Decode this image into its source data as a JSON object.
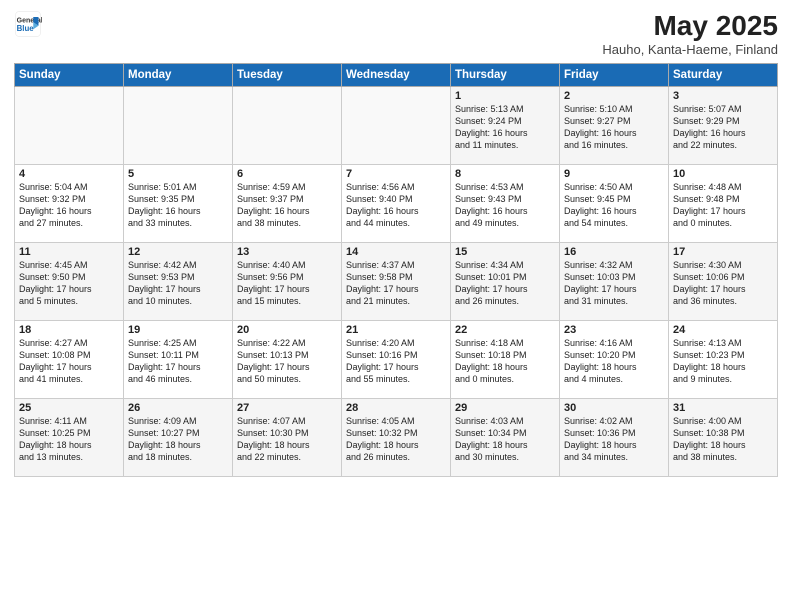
{
  "header": {
    "logo_line1": "General",
    "logo_line2": "Blue",
    "title": "May 2025",
    "subtitle": "Hauho, Kanta-Haeme, Finland"
  },
  "weekdays": [
    "Sunday",
    "Monday",
    "Tuesday",
    "Wednesday",
    "Thursday",
    "Friday",
    "Saturday"
  ],
  "weeks": [
    [
      {
        "day": "",
        "info": ""
      },
      {
        "day": "",
        "info": ""
      },
      {
        "day": "",
        "info": ""
      },
      {
        "day": "",
        "info": ""
      },
      {
        "day": "1",
        "info": "Sunrise: 5:13 AM\nSunset: 9:24 PM\nDaylight: 16 hours\nand 11 minutes."
      },
      {
        "day": "2",
        "info": "Sunrise: 5:10 AM\nSunset: 9:27 PM\nDaylight: 16 hours\nand 16 minutes."
      },
      {
        "day": "3",
        "info": "Sunrise: 5:07 AM\nSunset: 9:29 PM\nDaylight: 16 hours\nand 22 minutes."
      }
    ],
    [
      {
        "day": "4",
        "info": "Sunrise: 5:04 AM\nSunset: 9:32 PM\nDaylight: 16 hours\nand 27 minutes."
      },
      {
        "day": "5",
        "info": "Sunrise: 5:01 AM\nSunset: 9:35 PM\nDaylight: 16 hours\nand 33 minutes."
      },
      {
        "day": "6",
        "info": "Sunrise: 4:59 AM\nSunset: 9:37 PM\nDaylight: 16 hours\nand 38 minutes."
      },
      {
        "day": "7",
        "info": "Sunrise: 4:56 AM\nSunset: 9:40 PM\nDaylight: 16 hours\nand 44 minutes."
      },
      {
        "day": "8",
        "info": "Sunrise: 4:53 AM\nSunset: 9:43 PM\nDaylight: 16 hours\nand 49 minutes."
      },
      {
        "day": "9",
        "info": "Sunrise: 4:50 AM\nSunset: 9:45 PM\nDaylight: 16 hours\nand 54 minutes."
      },
      {
        "day": "10",
        "info": "Sunrise: 4:48 AM\nSunset: 9:48 PM\nDaylight: 17 hours\nand 0 minutes."
      }
    ],
    [
      {
        "day": "11",
        "info": "Sunrise: 4:45 AM\nSunset: 9:50 PM\nDaylight: 17 hours\nand 5 minutes."
      },
      {
        "day": "12",
        "info": "Sunrise: 4:42 AM\nSunset: 9:53 PM\nDaylight: 17 hours\nand 10 minutes."
      },
      {
        "day": "13",
        "info": "Sunrise: 4:40 AM\nSunset: 9:56 PM\nDaylight: 17 hours\nand 15 minutes."
      },
      {
        "day": "14",
        "info": "Sunrise: 4:37 AM\nSunset: 9:58 PM\nDaylight: 17 hours\nand 21 minutes."
      },
      {
        "day": "15",
        "info": "Sunrise: 4:34 AM\nSunset: 10:01 PM\nDaylight: 17 hours\nand 26 minutes."
      },
      {
        "day": "16",
        "info": "Sunrise: 4:32 AM\nSunset: 10:03 PM\nDaylight: 17 hours\nand 31 minutes."
      },
      {
        "day": "17",
        "info": "Sunrise: 4:30 AM\nSunset: 10:06 PM\nDaylight: 17 hours\nand 36 minutes."
      }
    ],
    [
      {
        "day": "18",
        "info": "Sunrise: 4:27 AM\nSunset: 10:08 PM\nDaylight: 17 hours\nand 41 minutes."
      },
      {
        "day": "19",
        "info": "Sunrise: 4:25 AM\nSunset: 10:11 PM\nDaylight: 17 hours\nand 46 minutes."
      },
      {
        "day": "20",
        "info": "Sunrise: 4:22 AM\nSunset: 10:13 PM\nDaylight: 17 hours\nand 50 minutes."
      },
      {
        "day": "21",
        "info": "Sunrise: 4:20 AM\nSunset: 10:16 PM\nDaylight: 17 hours\nand 55 minutes."
      },
      {
        "day": "22",
        "info": "Sunrise: 4:18 AM\nSunset: 10:18 PM\nDaylight: 18 hours\nand 0 minutes."
      },
      {
        "day": "23",
        "info": "Sunrise: 4:16 AM\nSunset: 10:20 PM\nDaylight: 18 hours\nand 4 minutes."
      },
      {
        "day": "24",
        "info": "Sunrise: 4:13 AM\nSunset: 10:23 PM\nDaylight: 18 hours\nand 9 minutes."
      }
    ],
    [
      {
        "day": "25",
        "info": "Sunrise: 4:11 AM\nSunset: 10:25 PM\nDaylight: 18 hours\nand 13 minutes."
      },
      {
        "day": "26",
        "info": "Sunrise: 4:09 AM\nSunset: 10:27 PM\nDaylight: 18 hours\nand 18 minutes."
      },
      {
        "day": "27",
        "info": "Sunrise: 4:07 AM\nSunset: 10:30 PM\nDaylight: 18 hours\nand 22 minutes."
      },
      {
        "day": "28",
        "info": "Sunrise: 4:05 AM\nSunset: 10:32 PM\nDaylight: 18 hours\nand 26 minutes."
      },
      {
        "day": "29",
        "info": "Sunrise: 4:03 AM\nSunset: 10:34 PM\nDaylight: 18 hours\nand 30 minutes."
      },
      {
        "day": "30",
        "info": "Sunrise: 4:02 AM\nSunset: 10:36 PM\nDaylight: 18 hours\nand 34 minutes."
      },
      {
        "day": "31",
        "info": "Sunrise: 4:00 AM\nSunset: 10:38 PM\nDaylight: 18 hours\nand 38 minutes."
      }
    ]
  ]
}
